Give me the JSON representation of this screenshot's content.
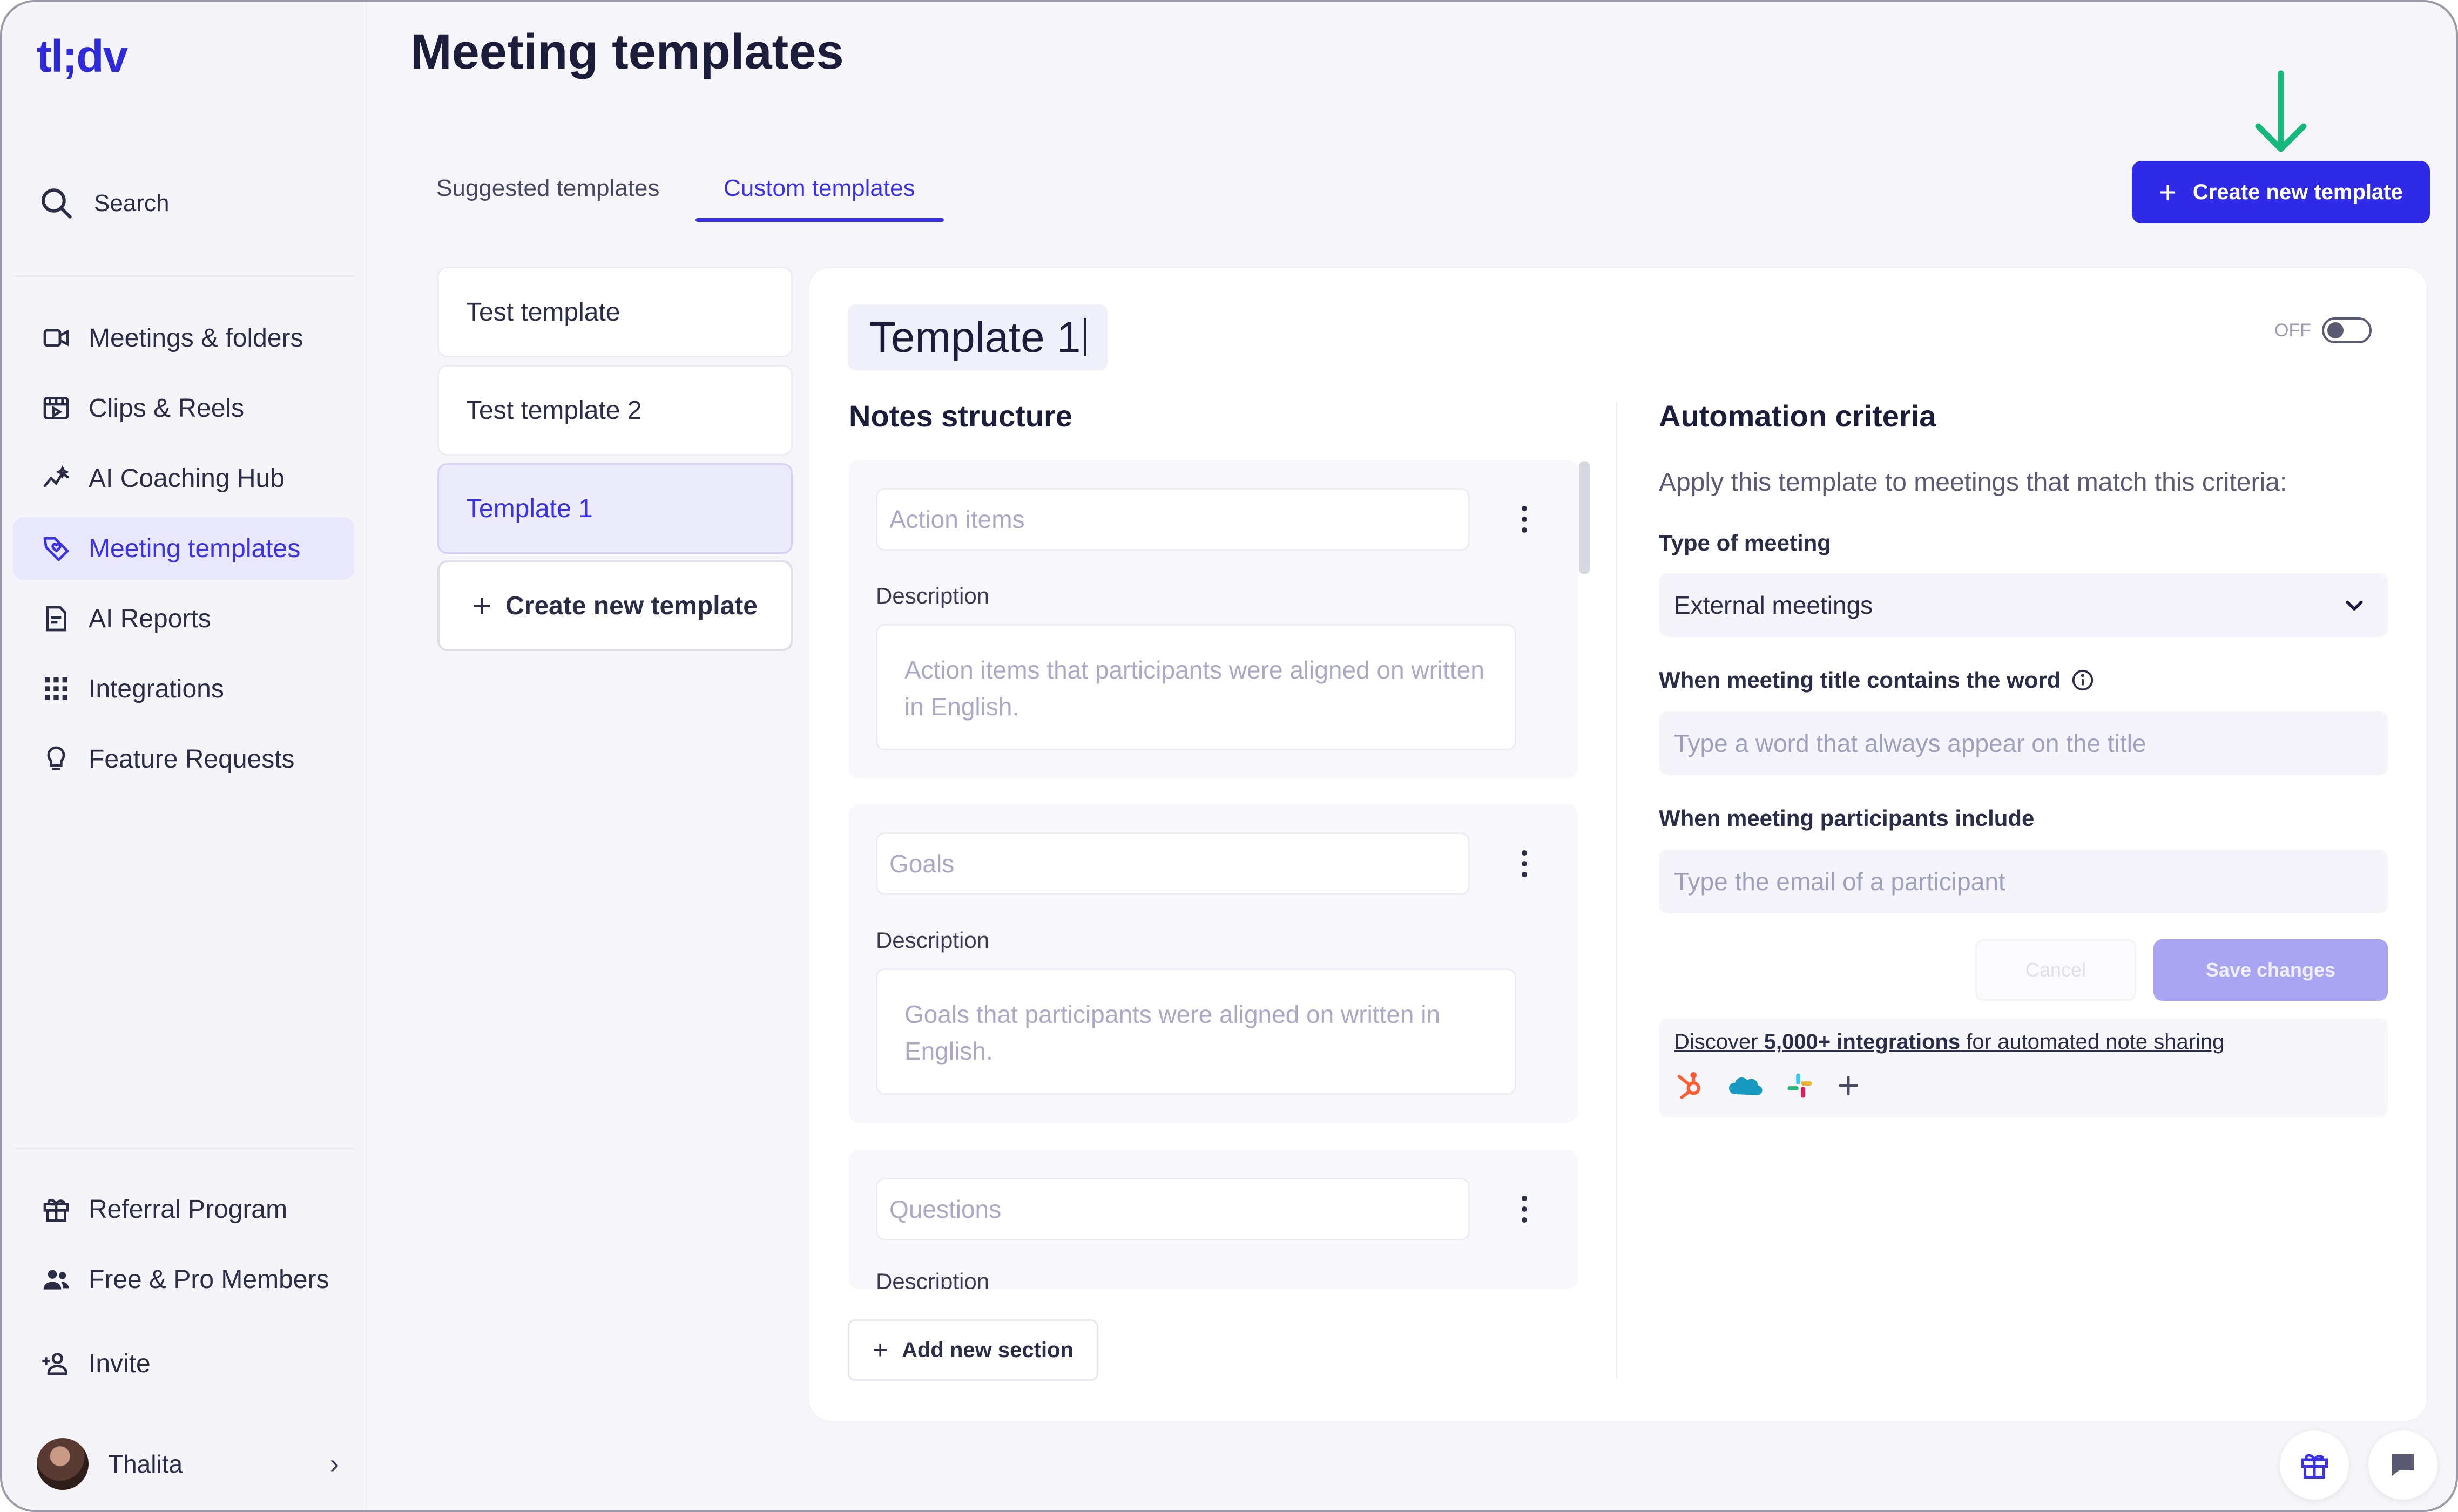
{
  "app": {
    "logo": "tl;dv"
  },
  "sidebar": {
    "search_label": "Search",
    "items": [
      {
        "label": "Meetings & folders",
        "icon": "video-camera-icon"
      },
      {
        "label": "Clips & Reels",
        "icon": "film-clip-icon"
      },
      {
        "label": "AI Coaching Hub",
        "icon": "trend-chart-icon"
      },
      {
        "label": "Meeting templates",
        "icon": "tag-heart-icon",
        "active": true
      },
      {
        "label": "AI Reports",
        "icon": "report-icon"
      },
      {
        "label": "Integrations",
        "icon": "grid-icon"
      },
      {
        "label": "Feature Requests",
        "icon": "lightbulb-icon"
      }
    ],
    "bottom_items": [
      {
        "label": "Referral Program",
        "icon": "gift-icon"
      },
      {
        "label": "Free & Pro Members",
        "icon": "users-icon"
      },
      {
        "label": "Invite",
        "icon": "add-user-icon"
      }
    ],
    "user": {
      "name": "Thalita"
    }
  },
  "header": {
    "title": "Meeting templates",
    "tabs": [
      {
        "label": "Suggested templates",
        "active": false
      },
      {
        "label": "Custom templates",
        "active": true
      }
    ],
    "create_button": "Create new template"
  },
  "templates": {
    "items": [
      {
        "label": "Test template"
      },
      {
        "label": "Test template 2"
      },
      {
        "label": "Template 1",
        "active": true
      }
    ],
    "create_label": "Create new template"
  },
  "editor": {
    "name": "Template 1",
    "toggle_label": "OFF",
    "notes_title": "Notes structure",
    "sections": [
      {
        "title_placeholder": "Action items",
        "description_label": "Description",
        "description_placeholder": "Action items that participants were aligned on written in English."
      },
      {
        "title_placeholder": "Goals",
        "description_label": "Description",
        "description_placeholder": "Goals that participants were aligned on written in English."
      },
      {
        "title_placeholder": "Questions",
        "description_label": "Description"
      }
    ],
    "add_section": "Add new section"
  },
  "automation": {
    "title": "Automation criteria",
    "subtitle": "Apply this template to meetings that match this criteria:",
    "type_label": "Type of meeting",
    "type_value": "External meetings",
    "title_word_label": "When meeting title contains the word",
    "title_word_placeholder": "Type a word that always appear on the title",
    "participants_label": "When meeting participants include",
    "participants_placeholder": "Type the email of a participant",
    "cancel": "Cancel",
    "save": "Save changes",
    "integrations_link_prefix": "Discover ",
    "integrations_link_bold": "5,000+ integrations",
    "integrations_link_suffix": " for automated note sharing",
    "integration_icons": [
      "hubspot-icon",
      "salesforce-icon",
      "slack-icon",
      "plus-icon"
    ]
  },
  "colors": {
    "brand": "#2f2ae6",
    "accent_text": "#3b31e6",
    "annotation_arrow": "#14b87a"
  }
}
